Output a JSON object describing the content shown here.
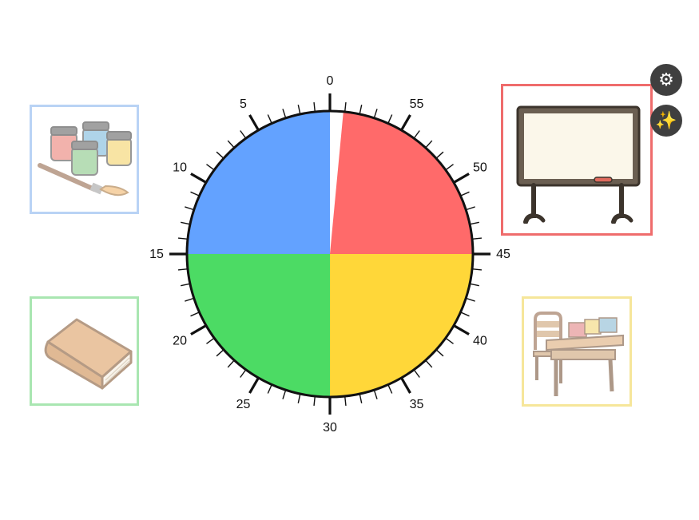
{
  "timer": {
    "labels": [
      "0",
      "5",
      "10",
      "15",
      "20",
      "25",
      "30",
      "35",
      "40",
      "45",
      "50",
      "55"
    ],
    "remaining_fraction": 0.985,
    "quadrant_colors": {
      "top_left": "#63a2ff",
      "top_right": "#ff6a6a",
      "bottom_left": "#4cdb64",
      "bottom_right": "#ffd739"
    },
    "gap_color": "#ffffff"
  },
  "stations": [
    {
      "name": "paint",
      "icon": "paint-jars-icon",
      "border_color": "#b9d3f5"
    },
    {
      "name": "reading",
      "icon": "book-icon",
      "border_color": "#a9e6b1"
    },
    {
      "name": "whiteboard",
      "icon": "whiteboard-icon",
      "border_color": "#ef6c6c"
    },
    {
      "name": "desk",
      "icon": "desk-blocks-icon",
      "border_color": "#f6e69a"
    }
  ],
  "controls": {
    "settings_icon": "⚙",
    "magic_icon": "✨"
  }
}
